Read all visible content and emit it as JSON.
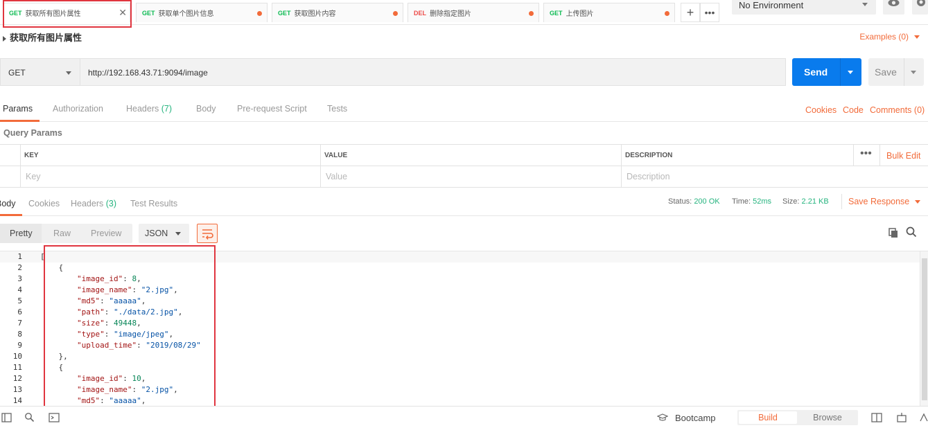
{
  "tabs": [
    {
      "method": "GET",
      "name": "获取所有图片属性",
      "active": true
    },
    {
      "method": "GET",
      "name": "获取单个图片信息"
    },
    {
      "method": "GET",
      "name": "获取图片内容"
    },
    {
      "method": "DEL",
      "name": "删除指定图片"
    },
    {
      "method": "GET",
      "name": "上传图片"
    }
  ],
  "environment": "No Environment",
  "request": {
    "title": "获取所有图片属性",
    "examples": "Examples (0)",
    "method": "GET",
    "url": "http://192.168.43.71:9094/image",
    "send": "Send",
    "save": "Save"
  },
  "request_tabs": {
    "params": "Params",
    "authorization": "Authorization",
    "headers": "Headers",
    "headers_count": "(7)",
    "body": "Body",
    "prerequest": "Pre-request Script",
    "tests": "Tests",
    "cookies": "Cookies",
    "code": "Code",
    "comments": "Comments (0)"
  },
  "query_params": {
    "title": "Query Params",
    "headers": {
      "key": "KEY",
      "value": "VALUE",
      "description": "DESCRIPTION"
    },
    "placeholders": {
      "key": "Key",
      "value": "Value",
      "description": "Description"
    },
    "bulk_edit": "Bulk Edit"
  },
  "response_tabs": {
    "body": "Body",
    "cookies": "Cookies",
    "headers": "Headers",
    "headers_count": "(3)",
    "test_results": "Test Results"
  },
  "response_status": {
    "status_label": "Status:",
    "status": "200 OK",
    "time_label": "Time:",
    "time": "52ms",
    "size_label": "Size:",
    "size": "2.21 KB",
    "save_response": "Save Response"
  },
  "format": {
    "pretty": "Pretty",
    "raw": "Raw",
    "preview": "Preview",
    "type": "JSON"
  },
  "code_lines": [
    {
      "n": "1",
      "text": "["
    },
    {
      "n": "2",
      "text": "    {"
    },
    {
      "n": "3",
      "key": "\"image_id\"",
      "val": "8",
      "vtype": "n"
    },
    {
      "n": "4",
      "key": "\"image_name\"",
      "val": "\"2.jpg\"",
      "vtype": "s"
    },
    {
      "n": "5",
      "key": "\"md5\"",
      "val": "\"aaaaa\"",
      "vtype": "s"
    },
    {
      "n": "6",
      "key": "\"path\"",
      "val": "\"./data/2.jpg\"",
      "vtype": "s"
    },
    {
      "n": "7",
      "key": "\"size\"",
      "val": "49448",
      "vtype": "n"
    },
    {
      "n": "8",
      "key": "\"type\"",
      "val": "\"image/jpeg\"",
      "vtype": "s"
    },
    {
      "n": "9",
      "key": "\"upload_time\"",
      "val": "\"2019/08/29\"",
      "vtype": "s",
      "last": true
    },
    {
      "n": "10",
      "text": "    },"
    },
    {
      "n": "11",
      "text": "    {"
    },
    {
      "n": "12",
      "key": "\"image_id\"",
      "val": "10",
      "vtype": "n"
    },
    {
      "n": "13",
      "key": "\"image_name\"",
      "val": "\"2.jpg\"",
      "vtype": "s"
    },
    {
      "n": "14",
      "key": "\"md5\"",
      "val": "\"aaaaa\"",
      "vtype": "s"
    }
  ],
  "statusbar": {
    "bootcamp": "Bootcamp",
    "build": "Build",
    "browse": "Browse"
  },
  "colors": {
    "accent": "#f26b3a",
    "send": "#097bed",
    "get": "#0cbb52",
    "del": "#ed4b48",
    "ok": "#26b47f",
    "highlight_box": "#e0353f"
  }
}
